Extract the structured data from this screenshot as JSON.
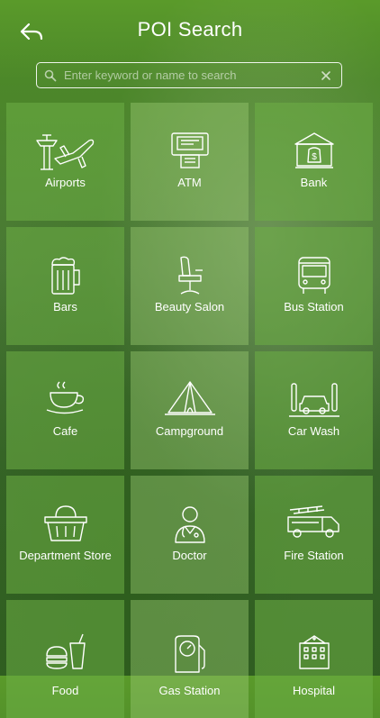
{
  "header": {
    "title": "POI Search",
    "back_icon": "back-arrow-icon"
  },
  "search": {
    "placeholder": "Enter keyword or name to search",
    "value": "",
    "icon": "search-icon",
    "clear_icon": "clear-icon"
  },
  "colors": {
    "tile": "#6eaf46",
    "text": "#ffffff"
  },
  "categories": [
    {
      "label": "Airports",
      "icon": "airport-icon"
    },
    {
      "label": "ATM",
      "icon": "atm-icon"
    },
    {
      "label": "Bank",
      "icon": "bank-icon"
    },
    {
      "label": "Bars",
      "icon": "beer-mug-icon"
    },
    {
      "label": "Beauty Salon",
      "icon": "salon-chair-icon"
    },
    {
      "label": "Bus Station",
      "icon": "bus-icon"
    },
    {
      "label": "Cafe",
      "icon": "coffee-cup-icon"
    },
    {
      "label": "Campground",
      "icon": "tent-icon"
    },
    {
      "label": "Car Wash",
      "icon": "car-wash-icon"
    },
    {
      "label": "Department Store",
      "icon": "shopping-basket-icon"
    },
    {
      "label": "Doctor",
      "icon": "doctor-icon"
    },
    {
      "label": "Fire Station",
      "icon": "fire-truck-icon"
    },
    {
      "label": "Food",
      "icon": "food-icon"
    },
    {
      "label": "Gas Station",
      "icon": "gas-pump-icon"
    },
    {
      "label": "Hospital",
      "icon": "hospital-icon"
    }
  ]
}
